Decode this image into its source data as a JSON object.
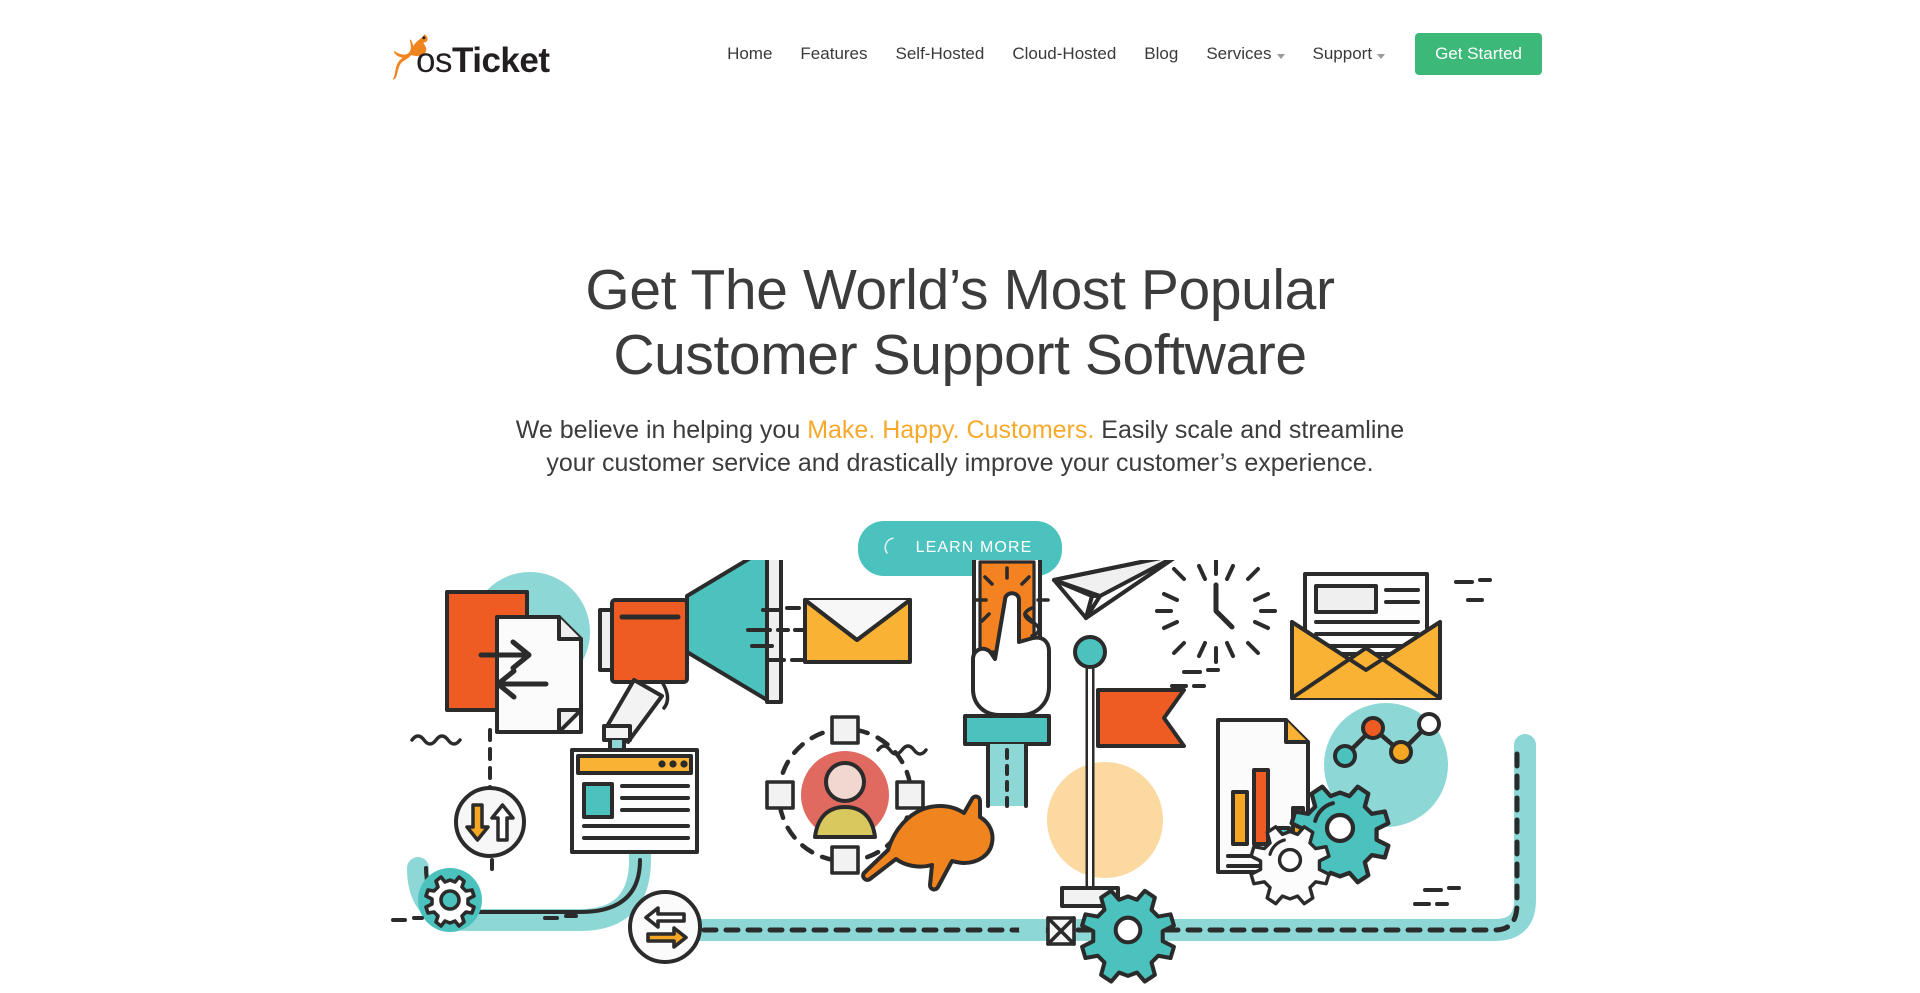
{
  "header": {
    "logo": {
      "icon": "kangaroo-logo-icon",
      "text_light": "os",
      "text_bold": "Ticket",
      "color_orange": "#f0841f"
    },
    "nav_items": [
      {
        "label": "Home",
        "has_dropdown": false
      },
      {
        "label": "Features",
        "has_dropdown": false
      },
      {
        "label": "Self-Hosted",
        "has_dropdown": false
      },
      {
        "label": "Cloud-Hosted",
        "has_dropdown": false
      },
      {
        "label": "Blog",
        "has_dropdown": false
      },
      {
        "label": "Services",
        "has_dropdown": true
      },
      {
        "label": "Support",
        "has_dropdown": true
      }
    ],
    "cta": {
      "label": "Get Started",
      "color": "#3cb878"
    }
  },
  "hero": {
    "title_line1": "Get The World’s Most Popular",
    "title_line2": "Customer Support Software",
    "sub_before": "We believe in helping you ",
    "sub_highlight": "Make. Happy. Customers.",
    "sub_after": " Easily scale and streamline",
    "sub_line2": "your customer service and drastically improve your customer’s experience.",
    "highlight_color": "#f7a92b",
    "button": {
      "label": "LEARN MORE",
      "icon": "arc-spinner-icon",
      "color": "#4cc2bf"
    }
  },
  "illustration": {
    "name": "customer-support-hero-illustration",
    "colors": {
      "teal": "#4cc2bf",
      "teal_light": "#8dd8d6",
      "orange": "#ef5c23",
      "yellow": "#f9b233",
      "red": "#e06a60",
      "tan": "#fbd9a0",
      "ink": "#2b2b2b",
      "white": "#ffffff",
      "grey": "#f2f2f2"
    },
    "elements": [
      "documents-exchange-icon",
      "teal-circle",
      "megaphone-icon",
      "sync-arrows-circle-icon",
      "browser-window-icon",
      "gear-circle-icon",
      "envelope-icon",
      "avatar-network-icon",
      "kangaroo-icon",
      "hand-tap-phone-icon",
      "paper-plane-icon",
      "clock-icon",
      "flag-pole-icon",
      "chart-document-icon",
      "open-envelope-letter-icon",
      "node-graph-circle-icon",
      "gears-icon",
      "swap-arrows-circle-icon",
      "teal-pipe-path"
    ]
  }
}
